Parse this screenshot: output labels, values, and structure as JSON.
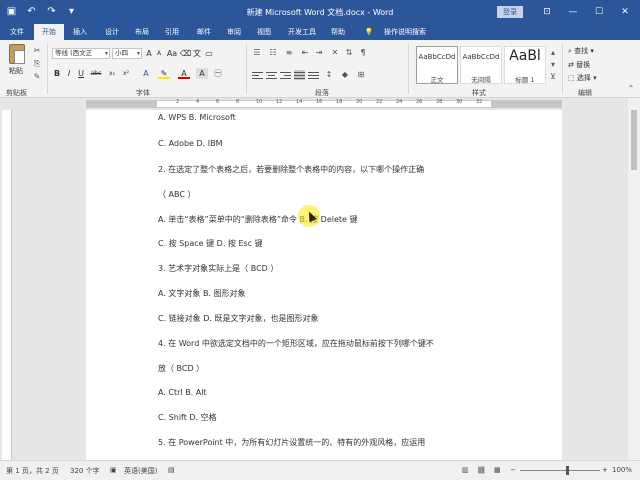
{
  "window": {
    "title": "新建 Microsoft Word 文档.docx - Word",
    "login_label": "登录",
    "qat_icons": [
      "save-icon",
      "undo-icon",
      "redo-icon",
      "customize-icon"
    ]
  },
  "tabs": {
    "items": [
      {
        "label": "文件"
      },
      {
        "label": "开始"
      },
      {
        "label": "插入"
      },
      {
        "label": "设计"
      },
      {
        "label": "布局"
      },
      {
        "label": "引用"
      },
      {
        "label": "邮件"
      },
      {
        "label": "审阅"
      },
      {
        "label": "视图"
      },
      {
        "label": "开发工具"
      },
      {
        "label": "帮助"
      },
      {
        "label": "操作说明搜索"
      }
    ],
    "active_index": 1
  },
  "ribbon": {
    "clipboard": {
      "paste_label": "粘贴",
      "group_label": "剪贴板"
    },
    "font": {
      "font_name": "等线 (西文正",
      "font_size": "小四",
      "size_box": "A",
      "group_label": "字体",
      "buttons": [
        "B",
        "I",
        "U",
        "abc",
        "x₂",
        "x²",
        "A",
        "A",
        "A"
      ]
    },
    "paragraph": {
      "group_label": "段落"
    },
    "styles": {
      "group_label": "样式",
      "items": [
        {
          "sample": "AaBbCcDd",
          "name": "正文"
        },
        {
          "sample": "AaBbCcDd",
          "name": "无间隔"
        },
        {
          "sample": "AaBl",
          "name": "标题 1"
        }
      ]
    },
    "editing": {
      "group_label": "编辑",
      "find_label": "查找",
      "replace_label": "替换",
      "select_label": "选择"
    }
  },
  "document": {
    "lines": [
      "A. WPS B. Microsoft",
      "C. Adobe D. IBM",
      "2. 在选定了整个表格之后，若要删除整个表格中的内容，以下哪个操作正确",
      "（ ABC ）",
      "A. 单击“表格”菜单中的“删除表格”命令 B. 按 Delete 键",
      "C. 按 Space 键 D. 按 Esc 键",
      "3. 艺术字对象实际上是（ BCD ）",
      "A. 文字对象 B. 图形对象",
      "C. 链接对象 D. 既是文字对象，也是图形对象",
      "4. 在 Word 中欲选定文档中的一个矩形区域，应在拖动鼠标前按下列哪个键不",
      "放（ BCD ）",
      "A. Ctrl B. Alt",
      "C. Shift D. 空格",
      "5. 在 PowerPoint 中，为所有幻灯片设置统一的、特有的外观风格，应运用"
    ]
  },
  "status": {
    "page": "第 1 页，共 2 页",
    "words": "320 个字",
    "language": "英语(美国)",
    "zoom": "100%"
  },
  "colors": {
    "accent": "#2b579a",
    "highlight": "#ffe600"
  }
}
